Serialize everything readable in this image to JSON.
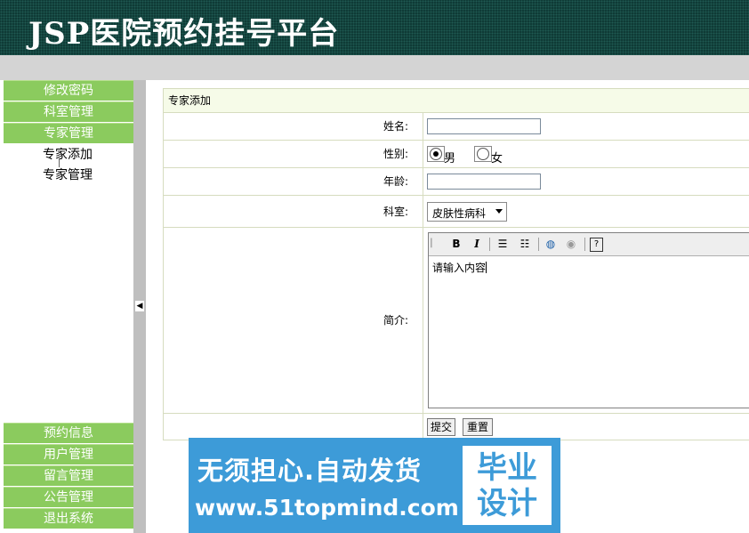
{
  "header": {
    "title": "JSP医院预约挂号平台"
  },
  "sidebar": {
    "top_menu": [
      "修改密码",
      "科室管理",
      "专家管理"
    ],
    "sub_items": [
      "专家添加",
      "专家管理"
    ],
    "bottom_menu": [
      "预约信息",
      "用户管理",
      "留言管理",
      "公告管理",
      "退出系统"
    ]
  },
  "form": {
    "title": "专家添加",
    "name_label": "姓名:",
    "name_value": "",
    "gender_label": "性别:",
    "gender_options": [
      "男",
      "女"
    ],
    "gender_selected": "男",
    "age_label": "年龄:",
    "age_value": "",
    "dept_label": "科室:",
    "dept_selected": "皮肤性病科",
    "intro_label": "简介:",
    "intro_text": "请输入内容",
    "submit_label": "提交",
    "reset_label": "重置"
  },
  "editor": {
    "toolbar_icons": [
      "bold-icon",
      "italic-icon",
      "ordered-list-icon",
      "unordered-list-icon",
      "link-icon",
      "image-icon",
      "help-icon"
    ]
  },
  "banner": {
    "line1": "无须担心.自动发货",
    "line2": "www.51topmind.com",
    "box_line1": "毕业",
    "box_line2": "设计"
  }
}
